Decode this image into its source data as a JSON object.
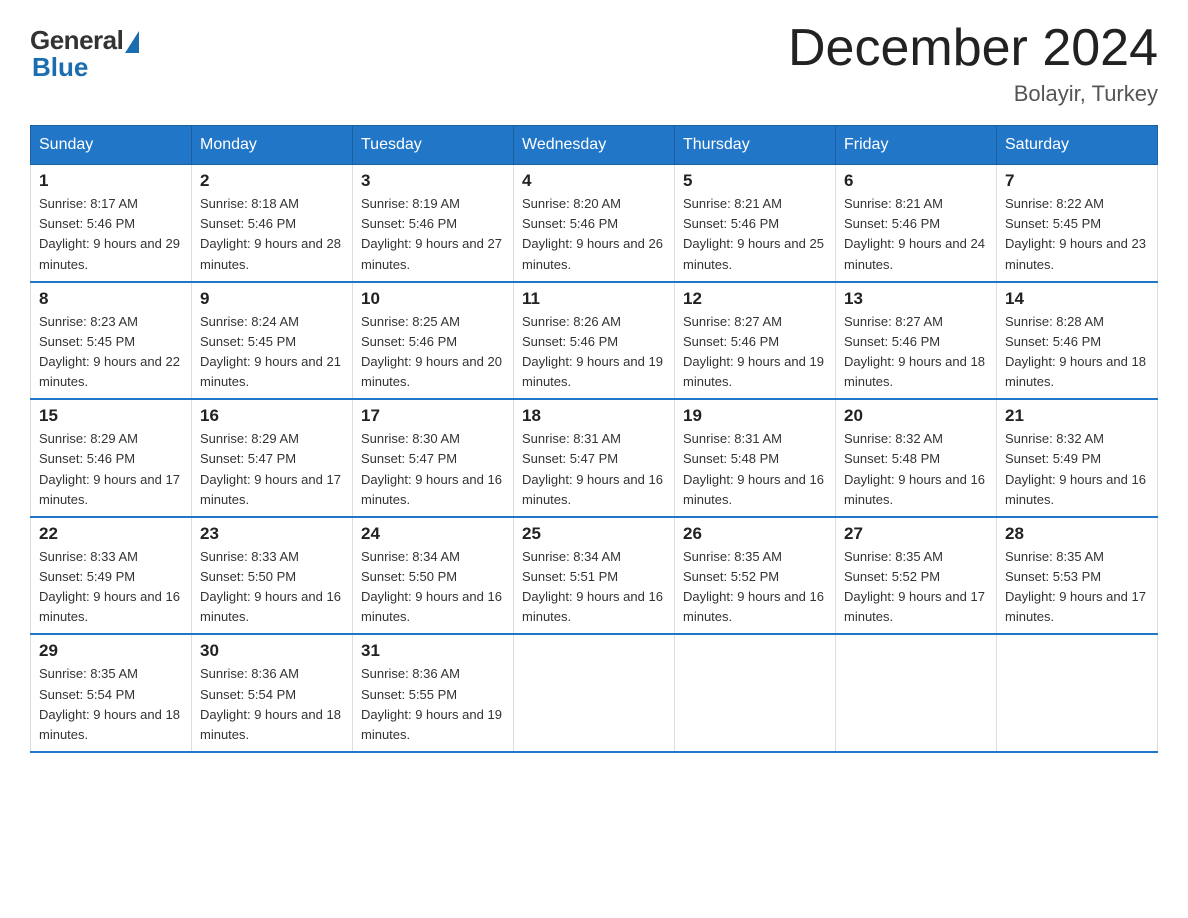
{
  "header": {
    "logo_general": "General",
    "logo_blue": "Blue",
    "main_title": "December 2024",
    "subtitle": "Bolayir, Turkey"
  },
  "days_of_week": [
    "Sunday",
    "Monday",
    "Tuesday",
    "Wednesday",
    "Thursday",
    "Friday",
    "Saturday"
  ],
  "weeks": [
    [
      {
        "day": "1",
        "sunrise": "8:17 AM",
        "sunset": "5:46 PM",
        "daylight": "9 hours and 29 minutes."
      },
      {
        "day": "2",
        "sunrise": "8:18 AM",
        "sunset": "5:46 PM",
        "daylight": "9 hours and 28 minutes."
      },
      {
        "day": "3",
        "sunrise": "8:19 AM",
        "sunset": "5:46 PM",
        "daylight": "9 hours and 27 minutes."
      },
      {
        "day": "4",
        "sunrise": "8:20 AM",
        "sunset": "5:46 PM",
        "daylight": "9 hours and 26 minutes."
      },
      {
        "day": "5",
        "sunrise": "8:21 AM",
        "sunset": "5:46 PM",
        "daylight": "9 hours and 25 minutes."
      },
      {
        "day": "6",
        "sunrise": "8:21 AM",
        "sunset": "5:46 PM",
        "daylight": "9 hours and 24 minutes."
      },
      {
        "day": "7",
        "sunrise": "8:22 AM",
        "sunset": "5:45 PM",
        "daylight": "9 hours and 23 minutes."
      }
    ],
    [
      {
        "day": "8",
        "sunrise": "8:23 AM",
        "sunset": "5:45 PM",
        "daylight": "9 hours and 22 minutes."
      },
      {
        "day": "9",
        "sunrise": "8:24 AM",
        "sunset": "5:45 PM",
        "daylight": "9 hours and 21 minutes."
      },
      {
        "day": "10",
        "sunrise": "8:25 AM",
        "sunset": "5:46 PM",
        "daylight": "9 hours and 20 minutes."
      },
      {
        "day": "11",
        "sunrise": "8:26 AM",
        "sunset": "5:46 PM",
        "daylight": "9 hours and 19 minutes."
      },
      {
        "day": "12",
        "sunrise": "8:27 AM",
        "sunset": "5:46 PM",
        "daylight": "9 hours and 19 minutes."
      },
      {
        "day": "13",
        "sunrise": "8:27 AM",
        "sunset": "5:46 PM",
        "daylight": "9 hours and 18 minutes."
      },
      {
        "day": "14",
        "sunrise": "8:28 AM",
        "sunset": "5:46 PM",
        "daylight": "9 hours and 18 minutes."
      }
    ],
    [
      {
        "day": "15",
        "sunrise": "8:29 AM",
        "sunset": "5:46 PM",
        "daylight": "9 hours and 17 minutes."
      },
      {
        "day": "16",
        "sunrise": "8:29 AM",
        "sunset": "5:47 PM",
        "daylight": "9 hours and 17 minutes."
      },
      {
        "day": "17",
        "sunrise": "8:30 AM",
        "sunset": "5:47 PM",
        "daylight": "9 hours and 16 minutes."
      },
      {
        "day": "18",
        "sunrise": "8:31 AM",
        "sunset": "5:47 PM",
        "daylight": "9 hours and 16 minutes."
      },
      {
        "day": "19",
        "sunrise": "8:31 AM",
        "sunset": "5:48 PM",
        "daylight": "9 hours and 16 minutes."
      },
      {
        "day": "20",
        "sunrise": "8:32 AM",
        "sunset": "5:48 PM",
        "daylight": "9 hours and 16 minutes."
      },
      {
        "day": "21",
        "sunrise": "8:32 AM",
        "sunset": "5:49 PM",
        "daylight": "9 hours and 16 minutes."
      }
    ],
    [
      {
        "day": "22",
        "sunrise": "8:33 AM",
        "sunset": "5:49 PM",
        "daylight": "9 hours and 16 minutes."
      },
      {
        "day": "23",
        "sunrise": "8:33 AM",
        "sunset": "5:50 PM",
        "daylight": "9 hours and 16 minutes."
      },
      {
        "day": "24",
        "sunrise": "8:34 AM",
        "sunset": "5:50 PM",
        "daylight": "9 hours and 16 minutes."
      },
      {
        "day": "25",
        "sunrise": "8:34 AM",
        "sunset": "5:51 PM",
        "daylight": "9 hours and 16 minutes."
      },
      {
        "day": "26",
        "sunrise": "8:35 AM",
        "sunset": "5:52 PM",
        "daylight": "9 hours and 16 minutes."
      },
      {
        "day": "27",
        "sunrise": "8:35 AM",
        "sunset": "5:52 PM",
        "daylight": "9 hours and 17 minutes."
      },
      {
        "day": "28",
        "sunrise": "8:35 AM",
        "sunset": "5:53 PM",
        "daylight": "9 hours and 17 minutes."
      }
    ],
    [
      {
        "day": "29",
        "sunrise": "8:35 AM",
        "sunset": "5:54 PM",
        "daylight": "9 hours and 18 minutes."
      },
      {
        "day": "30",
        "sunrise": "8:36 AM",
        "sunset": "5:54 PM",
        "daylight": "9 hours and 18 minutes."
      },
      {
        "day": "31",
        "sunrise": "8:36 AM",
        "sunset": "5:55 PM",
        "daylight": "9 hours and 19 minutes."
      },
      null,
      null,
      null,
      null
    ]
  ]
}
